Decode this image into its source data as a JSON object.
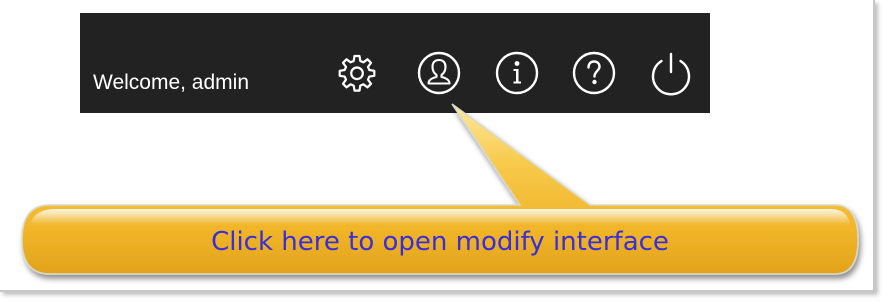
{
  "header": {
    "welcome_text": "Welcome, admin",
    "icons": [
      {
        "name": "settings-gear-icon"
      },
      {
        "name": "user-profile-icon"
      },
      {
        "name": "info-icon"
      },
      {
        "name": "help-icon"
      },
      {
        "name": "power-icon"
      }
    ]
  },
  "callout": {
    "text": "Click here to open modify interface"
  },
  "colors": {
    "topbar_bg": "#222222",
    "icon_color": "#ffffff",
    "callout_gold": "#f0b428",
    "callout_text": "#3a2fd6"
  }
}
